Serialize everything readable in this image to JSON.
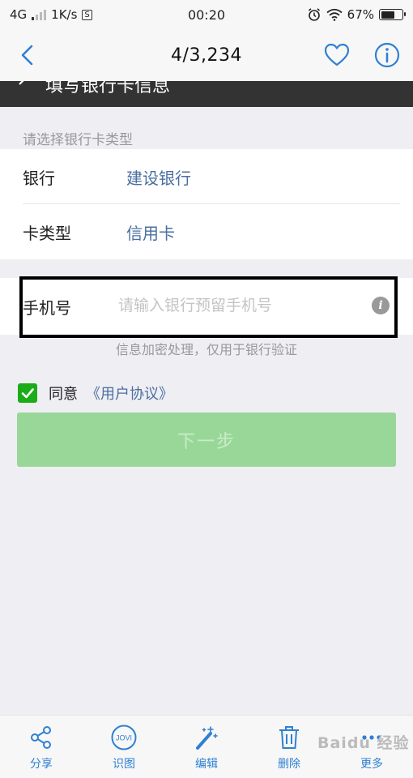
{
  "status_bar": {
    "network": "4G",
    "speed": "1K/s",
    "s_icon": "S",
    "time": "00:20",
    "battery": "67%",
    "battery_level": 0.67
  },
  "viewer": {
    "title": "4/3,234",
    "icons": [
      "back-chevron-icon",
      "heart-icon",
      "info-icon"
    ]
  },
  "page": {
    "header_title": "填写银行卡信息",
    "section_label": "请选择银行卡类型",
    "rows": [
      {
        "label": "银行",
        "value": "建设银行"
      },
      {
        "label": "卡类型",
        "value": "信用卡"
      }
    ],
    "phone": {
      "label": "手机号",
      "placeholder": "请输入银行预留手机号",
      "value": ""
    },
    "hint": "信息加密处理，仅用于银行验证",
    "agree_text": "同意",
    "agree_link": "《用户协议》",
    "agree_checked": true,
    "next_button": "下一步"
  },
  "toolbar": {
    "items": [
      {
        "label": "分享",
        "icon": "share-icon"
      },
      {
        "label": "识图",
        "icon": "jovi-icon"
      },
      {
        "label": "编辑",
        "icon": "magic-wand-icon"
      },
      {
        "label": "删除",
        "icon": "trash-icon"
      },
      {
        "label": "更多",
        "icon": "more-icon"
      }
    ]
  },
  "colors": {
    "accent": "#2f80d1",
    "link": "#4a6fa0",
    "green": "#1aad19",
    "button_disabled": "#99d799"
  }
}
